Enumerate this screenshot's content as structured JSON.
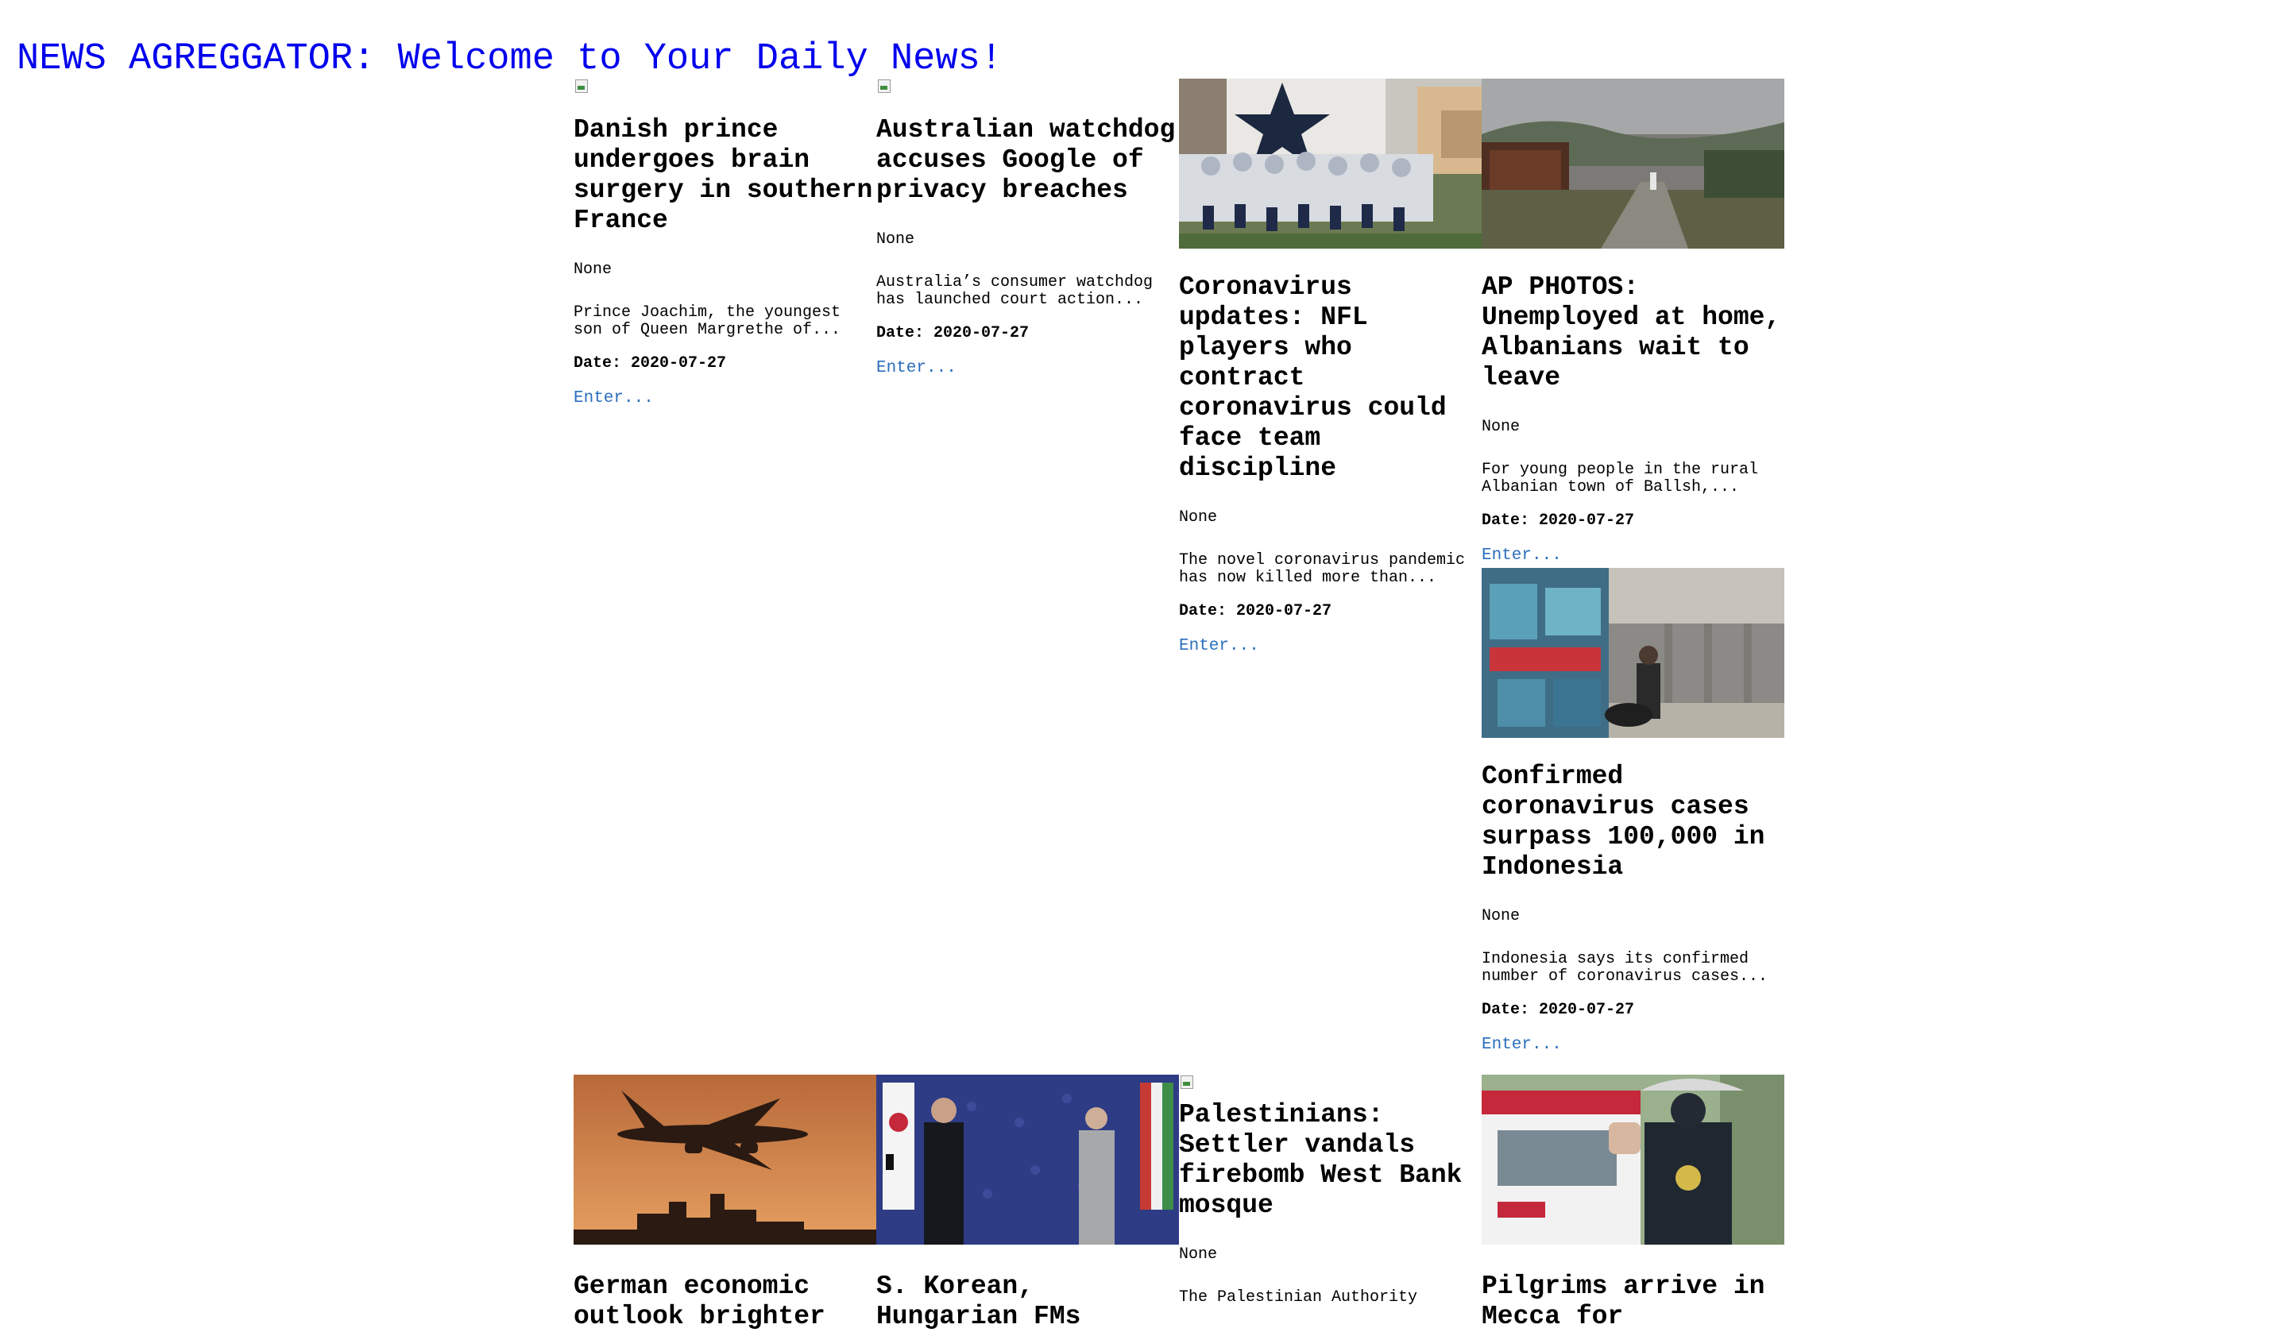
{
  "site": {
    "title": "NEWS AGREGGATOR: Welcome to Your Daily News!"
  },
  "articles": [
    {
      "title": "Danish prince undergoes brain surgery in southern France",
      "author": "None",
      "description": "Prince Joachim, the youngest son of Queen Margrethe of...",
      "date": "Date: 2020-07-27",
      "link": "Enter...",
      "image": "broken"
    },
    {
      "title": "Australian watchdog accuses Google of privacy breaches",
      "author": "None",
      "description": "Australia’s consumer watchdog has launched court action...",
      "date": "Date: 2020-07-27",
      "link": "Enter...",
      "image": "broken"
    },
    {
      "title": "Coronavirus updates: NFL players who contract coronavirus could face team discipline",
      "author": "None",
      "description": "The novel coronavirus pandemic has now killed more than...",
      "date": "Date: 2020-07-27",
      "link": "Enter...",
      "image": "football-team-photo"
    },
    {
      "title": "AP PHOTOS: Unemployed at home, Albanians wait to leave",
      "author": "None",
      "description": "For young people in the rural Albanian town of Ballsh,...",
      "date": "Date: 2020-07-27",
      "link": "Enter...",
      "image": "rural-town-photo"
    },
    {
      "title": "Confirmed coronavirus cases surpass 100,000 in Indonesia",
      "author": "None",
      "description": "Indonesia says its confirmed number of coronavirus cases...",
      "date": "Date: 2020-07-27",
      "link": "Enter...",
      "image": "street-vendor-photo"
    },
    {
      "title": "German economic outlook brighter",
      "image": "airplane-skyline-photo"
    },
    {
      "title": "S. Korean, Hungarian FMs",
      "image": "diplomats-flags-photo"
    },
    {
      "title": "Palestinians: Settler vandals firebomb West Bank mosque",
      "author": "None",
      "description": "The Palestinian Authority",
      "image": "broken"
    },
    {
      "title": "Pilgrims arrive in Mecca for",
      "image": "ambulance-guard-photo"
    }
  ],
  "colors": {
    "title": "#0000ee",
    "link": "#2a6ebb"
  }
}
